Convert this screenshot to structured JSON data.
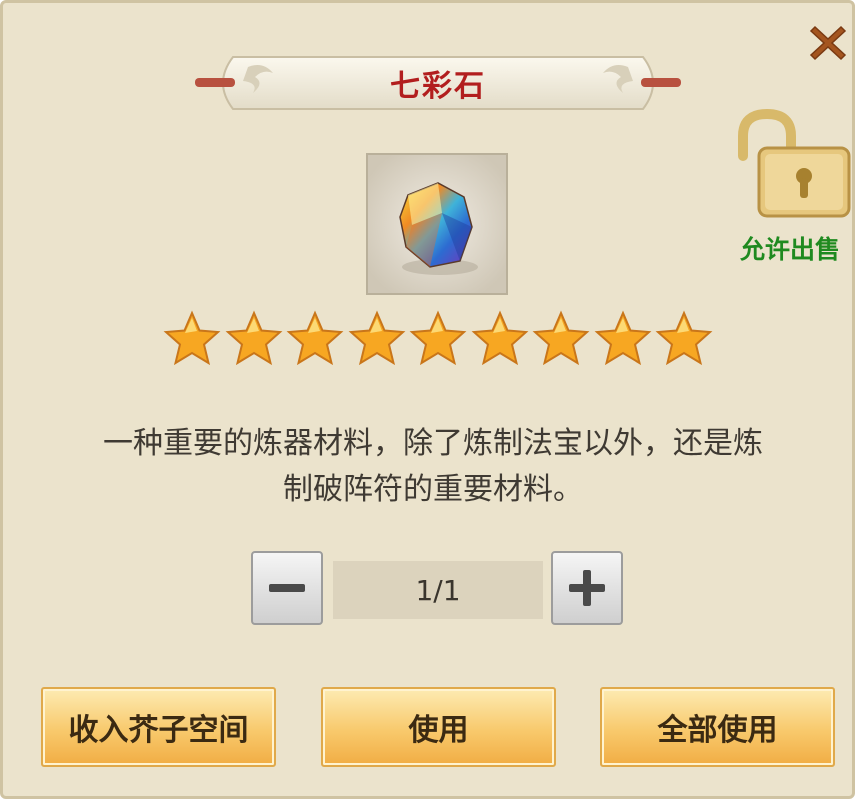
{
  "item": {
    "name": "七彩石",
    "stars": 9,
    "description_lines": [
      "一种重要的炼器材料，除了炼制法宝以外，还是炼",
      "制破阵符的重要材料。"
    ]
  },
  "lock": {
    "label": "允许出售"
  },
  "quantity": {
    "value": "1/1"
  },
  "actions": {
    "store_label": "收入芥子空间",
    "use_label": "使用",
    "use_all_label": "全部使用"
  },
  "icons": {
    "close": "close-icon",
    "lock": "unlocked-padlock-icon",
    "minus": "minus-icon",
    "plus": "plus-icon",
    "star": "star-icon",
    "item": "rainbow-gem-icon"
  },
  "colors": {
    "title": "#b21e1e",
    "lock_label": "#1f8a1f",
    "button_gold": "#f8c96c"
  }
}
